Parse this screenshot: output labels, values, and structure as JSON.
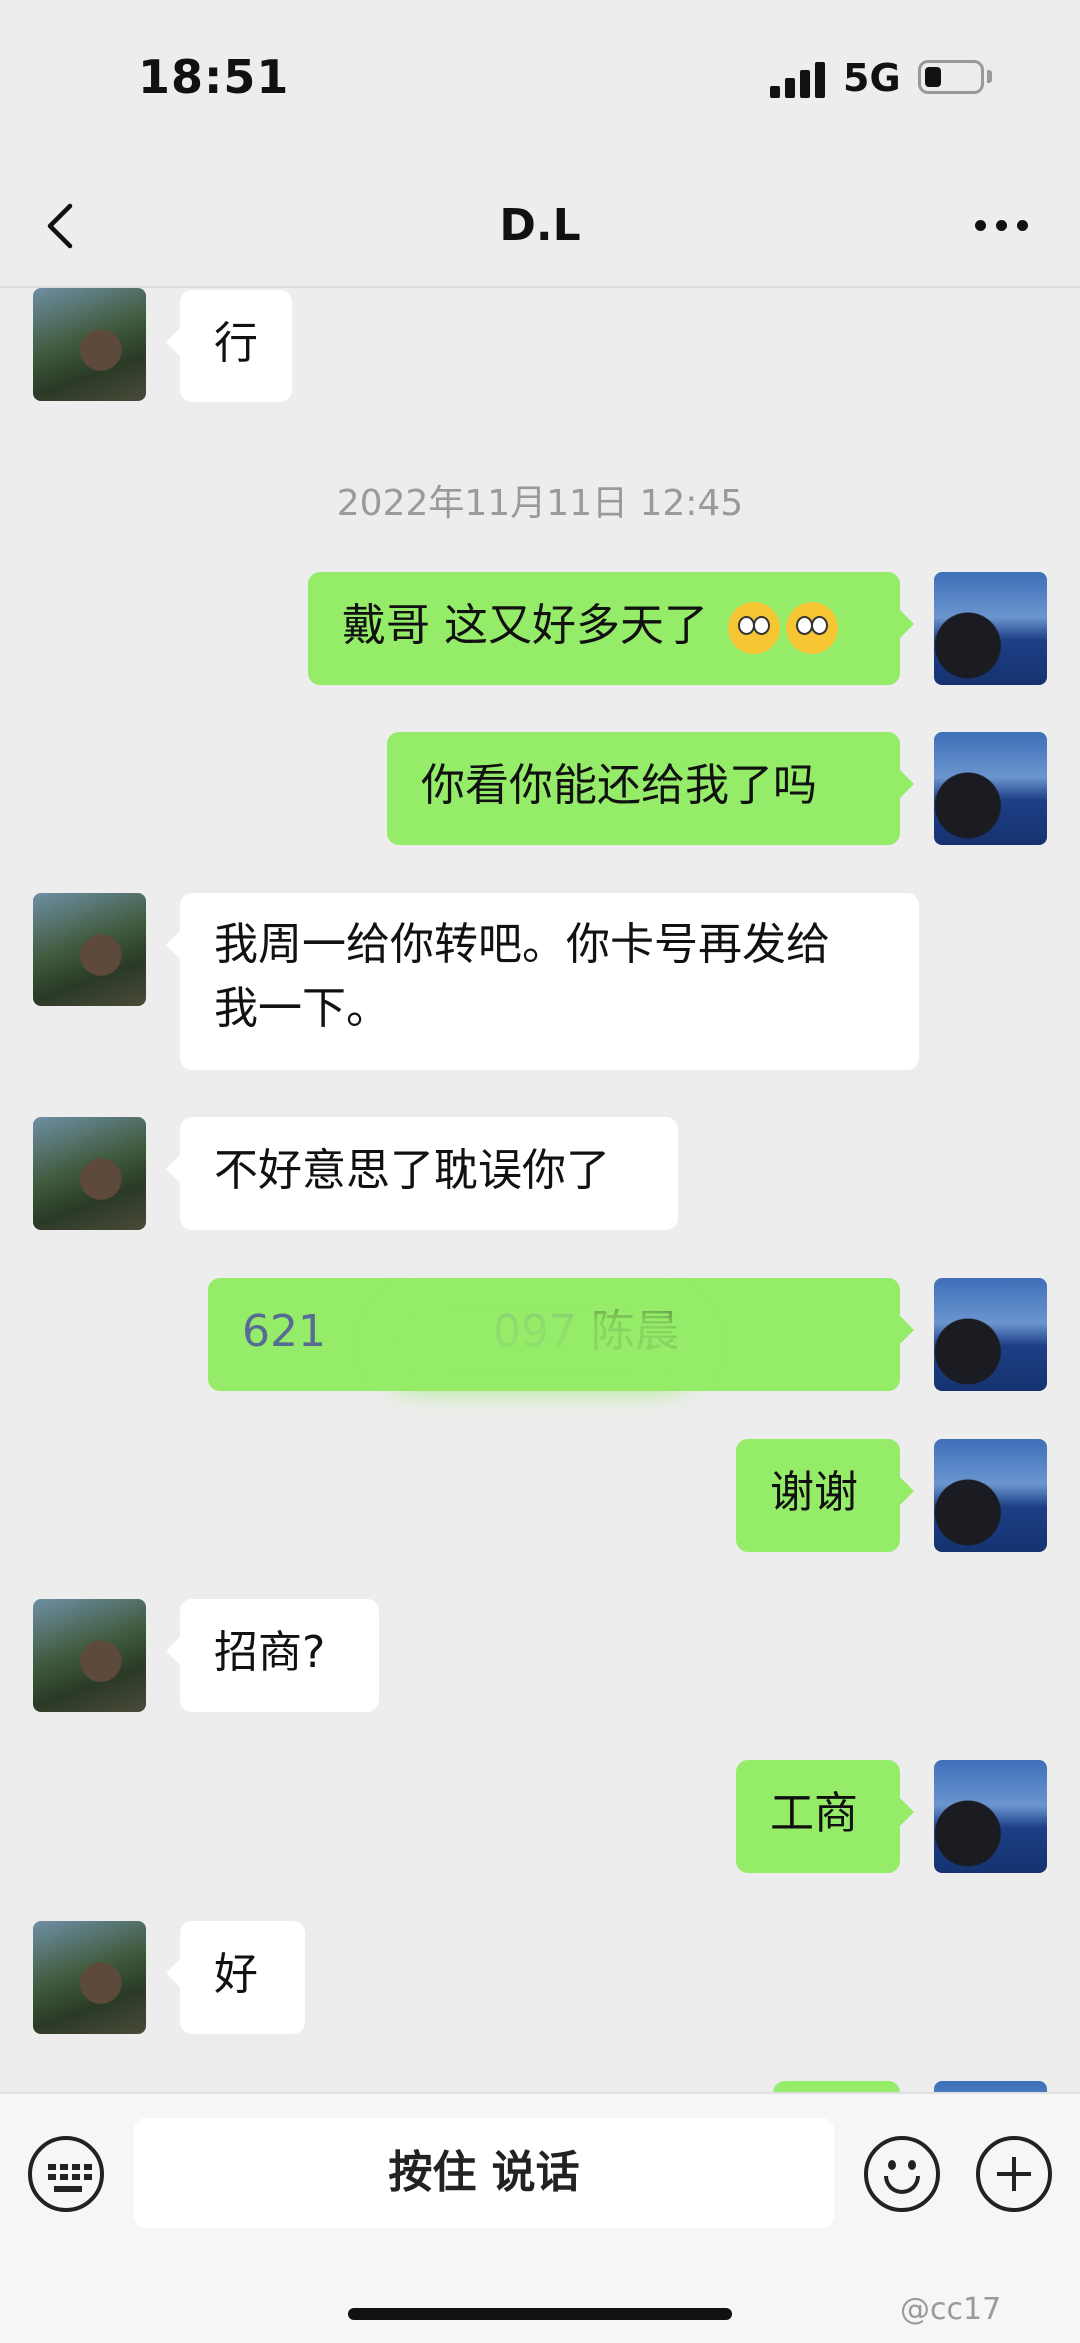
{
  "status_bar": {
    "time": "18:51",
    "network": "5G",
    "battery_level": 0.2
  },
  "nav": {
    "title": "D.L"
  },
  "messages": [
    {
      "from": "them",
      "text": "行"
    },
    {
      "type": "timestamp",
      "text": "2022年11月11日 12:45"
    },
    {
      "from": "me",
      "text": "戴哥 这又好多天了",
      "emoji": "flushed-face-icon x2"
    },
    {
      "from": "me",
      "text": "你看你能还给我了吗"
    },
    {
      "from": "them",
      "line1": "我周一给你转吧。你卡号再发给",
      "line2": "我一下。"
    },
    {
      "from": "them",
      "text": "不好意思了耽误你了"
    },
    {
      "from": "me",
      "account_visible": "621                   097",
      "name": "陈晨"
    },
    {
      "from": "me",
      "text": "谢谢"
    },
    {
      "from": "them",
      "text": "招商?"
    },
    {
      "from": "me",
      "text": "工商"
    },
    {
      "from": "them",
      "text": "好"
    }
  ],
  "input_bar": {
    "voice_label": "按住 说话"
  },
  "watermark": "@cc17"
}
